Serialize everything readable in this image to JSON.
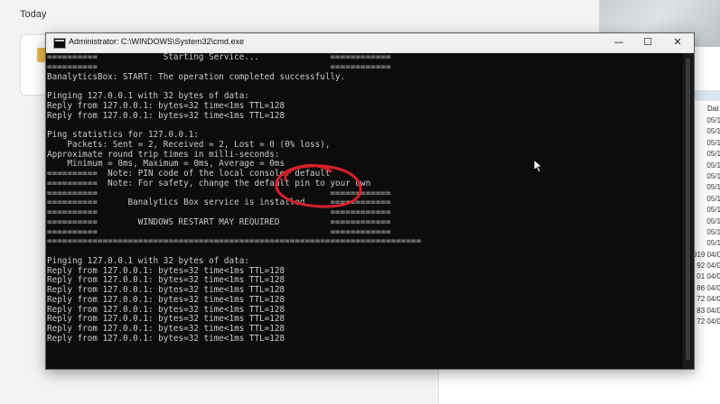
{
  "background": {
    "section_label": "Today",
    "column_header": "Dat",
    "column_cells": [
      "05/1",
      "05/1",
      "05/1",
      "05/1",
      "05/1",
      "05/1",
      "05/1",
      "05/1",
      "05/1",
      "05/1",
      "05/1",
      "05/1",
      "919 04/0",
      "92 04/0",
      "01 04/0",
      "86 04/0",
      "72 04/0",
      "83 04/0",
      "72 04/0"
    ]
  },
  "window": {
    "title": "Administrator: C:\\WINDOWS\\System32\\cmd.exe",
    "minimize_glyph": "—",
    "maximize_glyph": "☐",
    "close_glyph": "✕"
  },
  "console": {
    "lines": [
      "==========             Starting Service...              ============",
      "==========                                              ============",
      "BanalyticsBox: START: The operation completed successfully.",
      "",
      "Pinging 127.0.0.1 with 32 bytes of data:",
      "Reply from 127.0.0.1: bytes=32 time<1ms TTL=128",
      "Reply from 127.0.0.1: bytes=32 time<1ms TTL=128",
      "",
      "Ping statistics for 127.0.0.1:",
      "    Packets: Sent = 2, Received = 2, Lost = 0 (0% loss),",
      "Approximate round trip times in milli-seconds:",
      "    Minimum = 0ms, Maximum = 0ms, Average = 0ms",
      "==========  Note: PIN code of the local console: default",
      "==========  Note: For safety, change the default pin to your own",
      "==========                                              ============",
      "==========      Banalytics Box service is installed     ============",
      "==========                                              ============",
      "==========        WINDOWS RESTART MAY REQUIRED          ============",
      "==========                                              ============",
      "==========================================================================",
      "",
      "Pinging 127.0.0.1 with 32 bytes of data:",
      "Reply from 127.0.0.1: bytes=32 time<1ms TTL=128",
      "Reply from 127.0.0.1: bytes=32 time<1ms TTL=128",
      "Reply from 127.0.0.1: bytes=32 time<1ms TTL=128",
      "Reply from 127.0.0.1: bytes=32 time<1ms TTL=128",
      "Reply from 127.0.0.1: bytes=32 time<1ms TTL=128",
      "Reply from 127.0.0.1: bytes=32 time<1ms TTL=128",
      "Reply from 127.0.0.1: bytes=32 time<1ms TTL=128",
      "Reply from 127.0.0.1: bytes=32 time<1ms TTL=128"
    ]
  },
  "colors": {
    "console_bg": "#0c0c0c",
    "console_text": "#cccccc",
    "annotation_red": "#d8202a"
  },
  "icons": {
    "app": "cmd-icon",
    "cursor": "mouse-pointer-icon"
  }
}
